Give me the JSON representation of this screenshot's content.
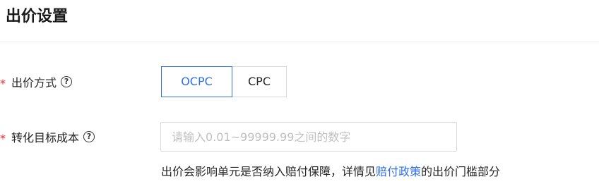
{
  "section": {
    "title": "出价设置"
  },
  "bid_method": {
    "required_mark": "*",
    "label": "出价方式",
    "help_icon": "question-circle-icon",
    "options": [
      "OCPC",
      "CPC"
    ],
    "selected": "OCPC"
  },
  "target_cost": {
    "required_mark": "*",
    "label": "转化目标成本",
    "help_icon": "question-circle-icon",
    "value": "",
    "placeholder": "请输入0.01~99999.99之间的数字"
  },
  "hint": {
    "prefix": "出价会影响单元是否纳入赔付保障，详情见",
    "link": "赔付政策",
    "suffix": "的出价门槛部分"
  },
  "colors": {
    "accent": "#2f6fea",
    "required": "#f5222d"
  }
}
